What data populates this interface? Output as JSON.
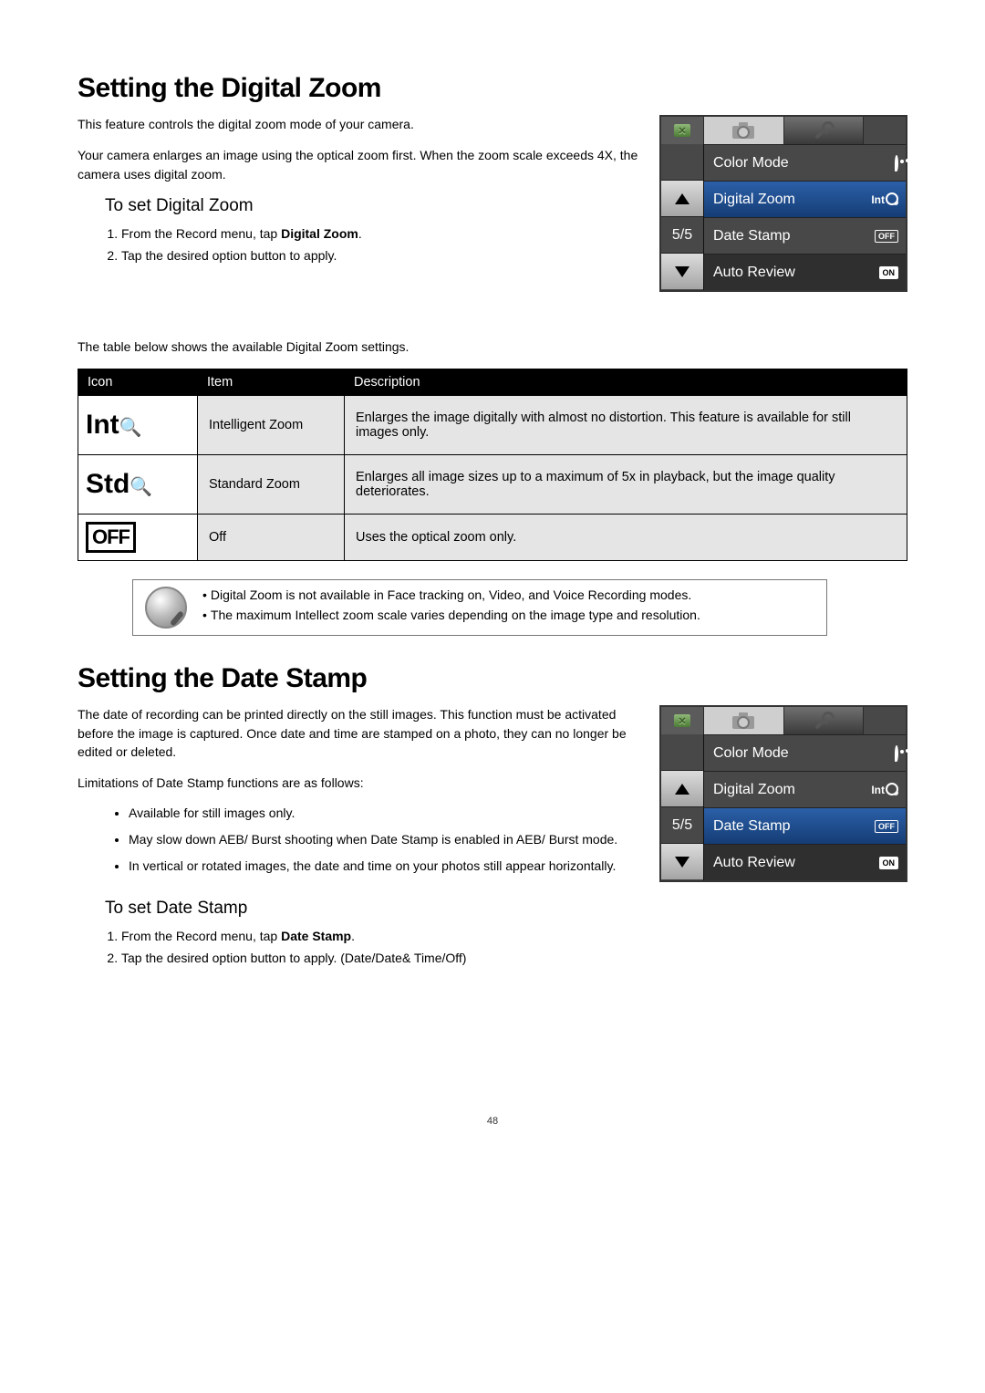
{
  "section1": {
    "heading": "Setting the Digital Zoom",
    "p1": "This feature controls the digital zoom mode of your camera.",
    "p2": "Your camera enlarges an image using the optical zoom first. When the zoom scale exceeds 4X, the camera uses digital zoom.",
    "sub": "To set Digital Zoom",
    "step1_pre": "From the Record menu, tap ",
    "step1_bold": "Digital Zoom",
    "step1_post": ".",
    "step2": "Tap the desired option button to apply.",
    "table_intro": "The table below shows the available Digital Zoom settings."
  },
  "table": {
    "h_icon": "Icon",
    "h_item": "Item",
    "h_desc": "Description",
    "rows": [
      {
        "icon_text": "Int",
        "item": "Intelligent Zoom",
        "desc": "Enlarges the image digitally with almost no distortion. This feature is available for still images only."
      },
      {
        "icon_text": "Std",
        "item": "Standard Zoom",
        "desc": "Enlarges all image sizes up to a maximum of 5x in playback, but the image quality deteriorates."
      },
      {
        "icon_text": "OFF",
        "item": "Off",
        "desc": "Uses the optical zoom only."
      }
    ]
  },
  "note": {
    "b1": "Digital Zoom is not available in Face tracking on, Video, and Voice Recording modes.",
    "b2": "The maximum Intellect zoom scale varies depending on the image type and resolution."
  },
  "section2": {
    "heading": "Setting the Date Stamp",
    "p1": "The date of recording can be printed directly on the still images. This function must be activated before the image is captured. Once date and time are stamped on a photo, they can no longer be edited or deleted.",
    "p2": "Limitations of Date Stamp functions are as follows:",
    "li1": "Available for still images only.",
    "li2": "May slow down AEB/ Burst shooting when Date Stamp is enabled in AEB/ Burst mode.",
    "li3": "In vertical or rotated images, the date and time on your photos still appear horizontally.",
    "sub": "To set Date Stamp",
    "step1_pre": "From the Record menu, tap ",
    "step1_bold": "Date Stamp",
    "step1_post": ".",
    "step2": "Tap the desired option button to apply. (Date/Date& Time/Off)"
  },
  "menu": {
    "page": "5/5",
    "items": [
      {
        "label": "Color Mode",
        "value_icon": "palette"
      },
      {
        "label": "Digital Zoom",
        "value_icon": "int-mag"
      },
      {
        "label": "Date Stamp",
        "value_icon": "off-badge"
      },
      {
        "label": "Auto Review",
        "value_icon": "on-badge"
      }
    ],
    "off_text": "OFF",
    "on_text": "ON",
    "int_text": "Int"
  },
  "menu2": {
    "page": "5/5",
    "highlight_index": 2
  },
  "footer": "48"
}
